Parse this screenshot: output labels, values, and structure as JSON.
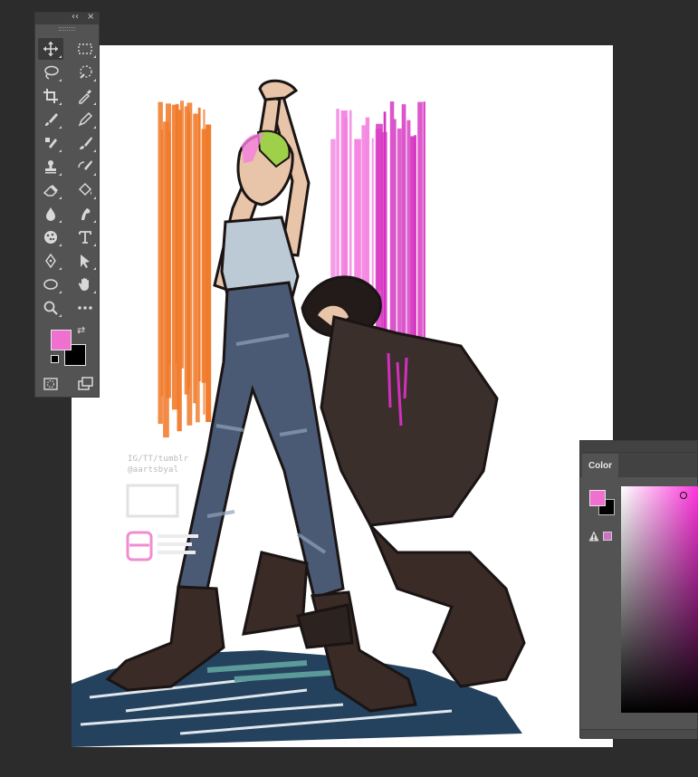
{
  "tools_panel": {
    "collapse_glyph": "‹‹",
    "close_glyph": "×",
    "tools": [
      {
        "name": "move-tool",
        "icon": "move-icon",
        "active": true
      },
      {
        "name": "rectangular-marquee-tool",
        "icon": "marquee-icon"
      },
      {
        "name": "lasso-tool",
        "icon": "lasso-icon"
      },
      {
        "name": "quick-selection-tool",
        "icon": "quick-selection-icon"
      },
      {
        "name": "crop-tool",
        "icon": "crop-icon"
      },
      {
        "name": "eyedropper-tool",
        "icon": "eyedropper-icon"
      },
      {
        "name": "brush-tool",
        "icon": "brush-icon"
      },
      {
        "name": "pencil-tool",
        "icon": "pencil-icon"
      },
      {
        "name": "clone-stamp-tool",
        "icon": "clone-stamp-icon"
      },
      {
        "name": "mixer-brush-tool",
        "icon": "mixer-brush-icon"
      },
      {
        "name": "stamp-tool",
        "icon": "stamp-icon"
      },
      {
        "name": "history-brush-tool",
        "icon": "history-brush-icon"
      },
      {
        "name": "eraser-tool",
        "icon": "eraser-icon"
      },
      {
        "name": "paint-bucket-tool",
        "icon": "paint-bucket-icon"
      },
      {
        "name": "blur-tool",
        "icon": "blur-drop-icon"
      },
      {
        "name": "smudge-tool",
        "icon": "smudge-icon"
      },
      {
        "name": "sponge-tool",
        "icon": "sponge-icon"
      },
      {
        "name": "type-tool",
        "icon": "type-icon",
        "label": "T"
      },
      {
        "name": "pen-tool",
        "icon": "pen-icon"
      },
      {
        "name": "path-selection-tool",
        "icon": "arrow-icon"
      },
      {
        "name": "ellipse-tool",
        "icon": "ellipse-icon"
      },
      {
        "name": "hand-tool",
        "icon": "hand-icon"
      },
      {
        "name": "zoom-tool",
        "icon": "zoom-icon"
      },
      {
        "name": "more-tools",
        "icon": "ellipsis-icon",
        "label": "•••"
      },
      {
        "name": "quick-mask",
        "icon": "quick-mask-icon"
      },
      {
        "name": "screen-mode",
        "icon": "screen-mode-icon"
      }
    ],
    "foreground_color": "#f070d0",
    "background_color": "#000000",
    "swap_glyph": "⇄"
  },
  "color_panel": {
    "tab_label": "Color",
    "foreground_color": "#f070d0",
    "background_color": "#000000",
    "gamut_warning_icon": "warning-icon",
    "gamut_swatch_color": "#d070c0",
    "hue_color": "#ff33dd"
  },
  "canvas": {
    "background": "#ffffff",
    "watermark": {
      "lines": [
        "IG/TT/tumblr",
        "@aartsbyal"
      ],
      "logo_color": "#f08ccf"
    },
    "colors": {
      "orange": "#f07a2a",
      "magenta": "#d42fbf",
      "pink": "#f47fe0",
      "denim": "#4a5a74",
      "boots": "#3a2b26",
      "skin": "#e8c4a8",
      "hair": "#231b1a",
      "green": "#9ed04a",
      "shirt": "#bccad6",
      "dress": "#3b2f2c",
      "floor": "#24425e",
      "teal": "#5a9a98"
    }
  }
}
